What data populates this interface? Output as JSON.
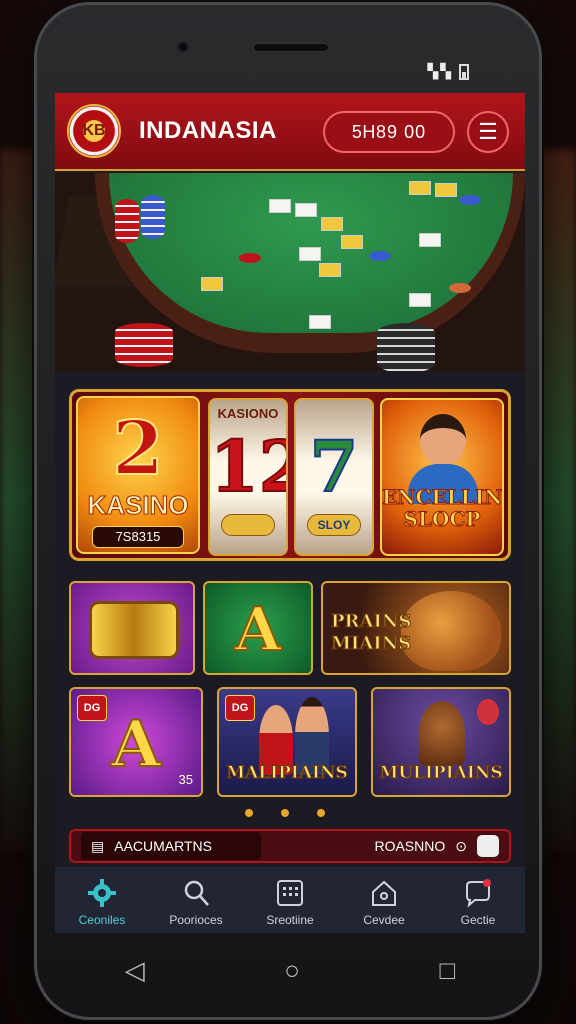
{
  "header": {
    "logo_text": "KB",
    "app_title": "INDANASIA",
    "balance": "5Ꮋ89  00",
    "menu_icon": "menu-icon"
  },
  "status_bar": {
    "signal": "▚▚"
  },
  "featured_slot": {
    "left_big": "2",
    "left_title": "KASINO",
    "left_code": "7S8315",
    "reel1_top": "KASIONO",
    "reel1_num": "12",
    "reel2_num": "7",
    "reel2_pill": "SLOY",
    "right_title": "ENCELLINO SLOCP"
  },
  "tiles": {
    "t3_text": "PRAINS MIAINS",
    "t4_badge": "DG",
    "t4_num": "35",
    "t5_badge": "DG",
    "t5_text": "MALIPIAINS",
    "t6_text": "MULIPIAINS"
  },
  "promo": {
    "left_label": "AACUMARTNS",
    "right_label": "ROASNNO"
  },
  "bottom_nav": [
    {
      "label": "Ceoniles",
      "icon": "gear-icon"
    },
    {
      "label": "Poorioces",
      "icon": "search-icon"
    },
    {
      "label": "Sreotiine",
      "icon": "grid-icon"
    },
    {
      "label": "Cevdee",
      "icon": "home-icon"
    },
    {
      "label": "Gectie",
      "icon": "chat-icon"
    }
  ],
  "colors": {
    "header_red": "#b3141b",
    "gold": "#d9a531",
    "nav_active": "#4ad2d8",
    "nav_bg": "#222634"
  }
}
